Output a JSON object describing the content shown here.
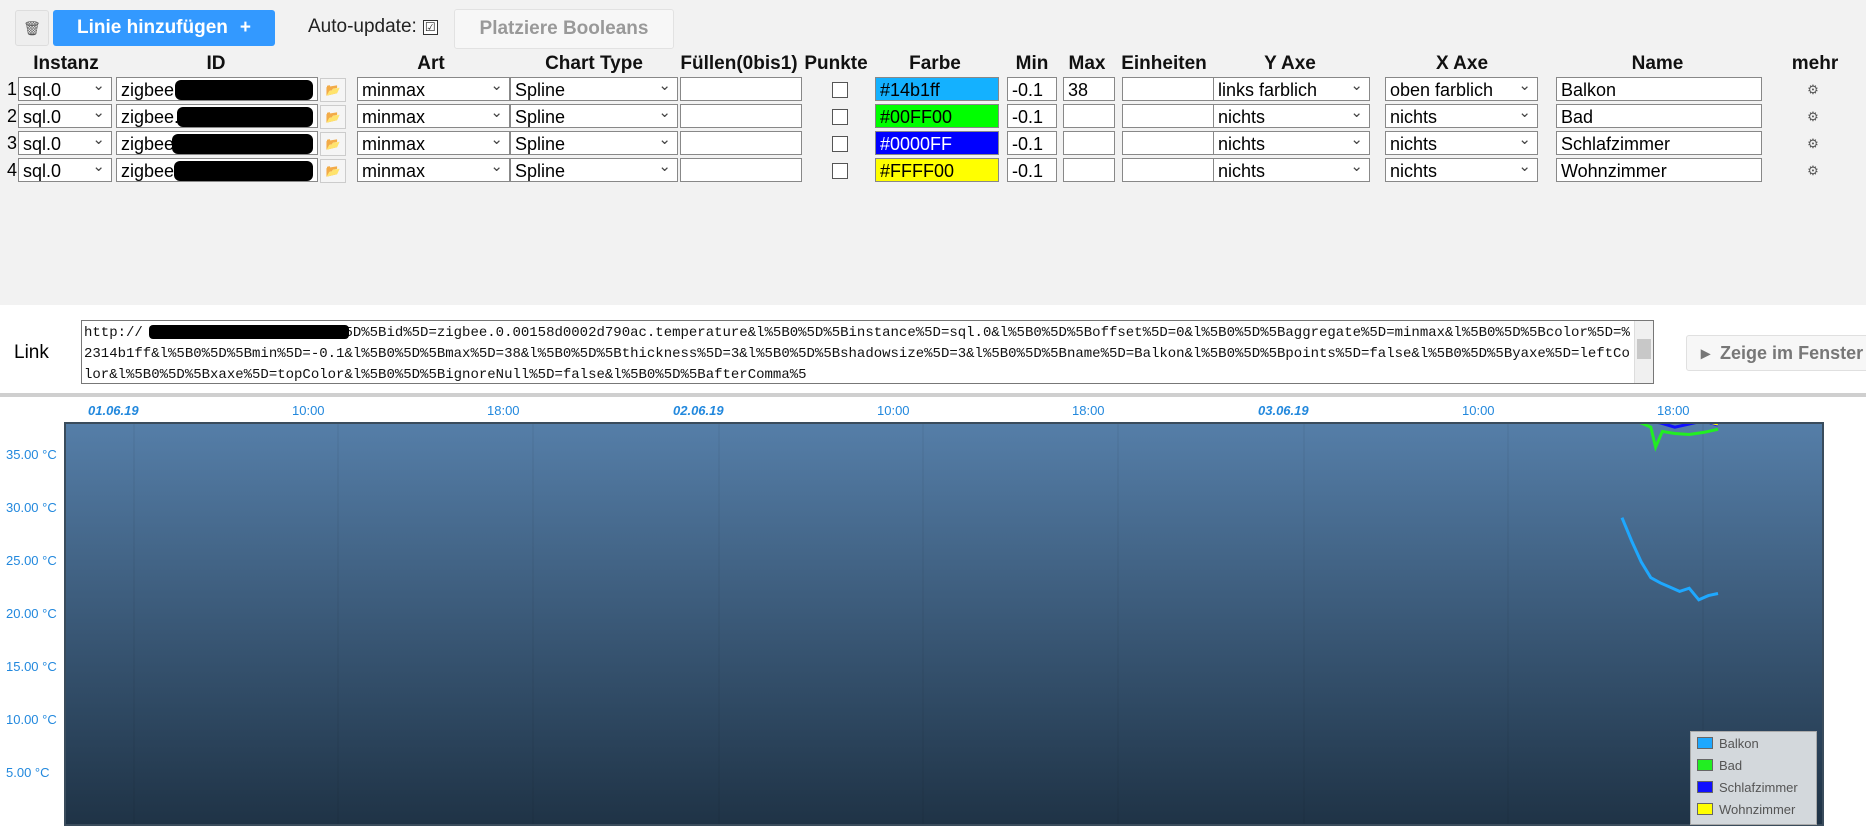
{
  "toolbar": {
    "add_label": "Linie hinzufügen",
    "add_plus": "+",
    "autoupdate_label": "Auto-update:",
    "autoupdate_check": "☑",
    "booleans_label": "Platziere Booleans"
  },
  "headers": [
    "Instanz",
    "ID",
    "Art",
    "Chart Type",
    "Füllen(0bis1)",
    "Punkte",
    "Farbe",
    "Min",
    "Max",
    "Einheiten",
    "Y Axe",
    "X Axe",
    "Name",
    "mehr"
  ],
  "rows": [
    {
      "num": "1",
      "instance": "sql.0",
      "id": "zigbee.",
      "art": "minmax",
      "chart_type": "Spline",
      "fill": "",
      "color": "#14b1ff",
      "min": "-0.1",
      "max": "38",
      "units": "",
      "yaxe": "links farblich",
      "xaxe": "oben farblich",
      "name": "Balkon"
    },
    {
      "num": "2",
      "instance": "sql.0",
      "id": "zigbee.",
      "art": "minmax",
      "chart_type": "Spline",
      "fill": "",
      "color": "#00FF00",
      "min": "-0.1",
      "max": "",
      "units": "",
      "yaxe": "nichts",
      "xaxe": "nichts",
      "name": "Bad"
    },
    {
      "num": "3",
      "instance": "sql.0",
      "id": "zigbee.",
      "art": "minmax",
      "chart_type": "Spline",
      "fill": "",
      "color": "#0000FF",
      "min": "-0.1",
      "max": "",
      "units": "",
      "yaxe": "nichts",
      "xaxe": "nichts",
      "name": "Schlafzimmer"
    },
    {
      "num": "4",
      "instance": "sql.0",
      "id": "zigbee.",
      "art": "minmax",
      "chart_type": "Spline",
      "fill": "",
      "color": "#FFFF00",
      "min": "-0.1",
      "max": "",
      "units": "",
      "yaxe": "nichts",
      "xaxe": "nichts",
      "name": "Wohnzimmer"
    }
  ],
  "link": {
    "label": "Link",
    "text": "http://                    /flot/index.html?l%5B0%5D%5Bid%5D=zigbee.0.00158d0002d790ac.temperature&l%5B0%5D%5Binstance%5D=sql.0&l%5B0%5D%5Boffset%5D=0&l%5B0%5D%5Baggregate%5D=minmax&l%5B0%5D%5Bcolor%5D=%2314b1ff&l%5B0%5D%5Bmin%5D=-0.1&l%5B0%5D%5Bmax%5D=38&l%5B0%5D%5Bthickness%5D=3&l%5B0%5D%5Bshadowsize%5D=3&l%5B0%5D%5Bname%5D=Balkon&l%5B0%5D%5Bpoints%5D=false&l%5B0%5D%5Byaxe%5D=leftColor&l%5B0%5D%5Bxaxe%5D=topColor&l%5B0%5D%5BignoreNull%5D=false&l%5B0%5D%5BafterComma%5",
    "show_label": "Zeige im Fenster",
    "show_arrow": "▸"
  },
  "icons": {
    "trash": "🗑",
    "folder": "📂",
    "gear": "⚙"
  },
  "chart_data": {
    "type": "line",
    "x_labels": [
      "01.06.19",
      "10:00",
      "18:00",
      "02.06.19",
      "10:00",
      "18:00",
      "03.06.19",
      "10:00",
      "18:00"
    ],
    "x_label_bold": [
      true,
      false,
      false,
      true,
      false,
      false,
      true,
      false,
      false
    ],
    "y_labels": [
      "35.00 °C",
      "30.00 °C",
      "25.00 °C",
      "20.00 °C",
      "15.00 °C",
      "10.00 °C",
      "5.00 °C"
    ],
    "ylim": [
      0,
      38
    ],
    "series": [
      {
        "name": "Balkon",
        "color": "#1ea8ff",
        "points": [
          [
            0,
            27.2
          ],
          [
            0.1,
            25
          ],
          [
            0.2,
            23
          ],
          [
            0.3,
            21.5
          ],
          [
            0.4,
            21
          ],
          [
            0.5,
            20.6
          ],
          [
            0.6,
            20.2
          ],
          [
            0.7,
            20.5
          ],
          [
            0.8,
            19.4
          ],
          [
            0.9,
            19.8
          ],
          [
            1,
            20
          ]
        ]
      },
      {
        "name": "Bad",
        "color": "#22ee22",
        "points": [
          [
            0,
            36.6
          ],
          [
            0.2,
            36.2
          ],
          [
            0.3,
            35.8
          ],
          [
            0.35,
            33.9
          ],
          [
            0.42,
            35.4
          ],
          [
            0.55,
            35.2
          ],
          [
            0.7,
            35.1
          ],
          [
            0.85,
            35.3
          ],
          [
            1,
            35.6
          ]
        ]
      },
      {
        "name": "Schlafzimmer",
        "color": "#1010ff",
        "points": [
          [
            0,
            36.6
          ],
          [
            0.2,
            36.5
          ],
          [
            0.4,
            36.2
          ],
          [
            0.55,
            35.8
          ],
          [
            0.7,
            36.1
          ],
          [
            0.85,
            36.4
          ],
          [
            1,
            36
          ]
        ]
      },
      {
        "name": "Wohnzimmer",
        "color": "#ffff00",
        "points": [
          [
            0,
            36.7
          ],
          [
            0.2,
            36.5
          ],
          [
            0.4,
            36.7
          ],
          [
            0.5,
            37.1
          ],
          [
            0.6,
            36.8
          ],
          [
            0.75,
            36.6
          ],
          [
            0.9,
            36.3
          ],
          [
            1,
            36.1
          ]
        ]
      }
    ],
    "legend": [
      "Balkon",
      "Bad",
      "Schlafzimmer",
      "Wohnzimmer"
    ],
    "legend_colors": [
      "#1ea8ff",
      "#22ee22",
      "#1010ff",
      "#ffff00"
    ]
  }
}
